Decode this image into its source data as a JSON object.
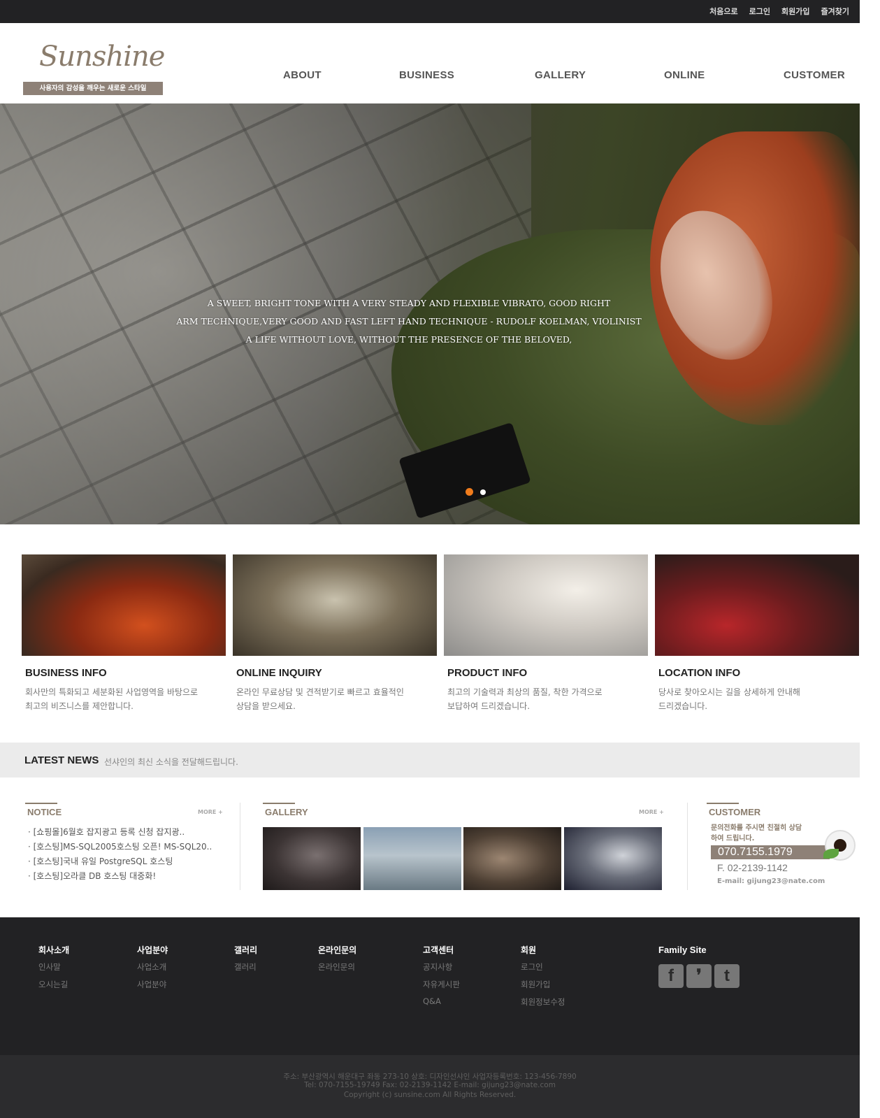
{
  "top_links": [
    "처음으로",
    "로그인",
    "회원가입",
    "즐겨찾기"
  ],
  "logo": {
    "script": "Sunshine",
    "tagline": "사용자의 감성을 깨우는 새로운 스타일"
  },
  "nav": [
    "ABOUT",
    "BUSINESS",
    "GALLERY",
    "ONLINE",
    "CUSTOMER"
  ],
  "hero": {
    "lines": [
      "A SWEET, BRIGHT TONE WITH A VERY STEADY AND FLEXIBLE VIBRATO, GOOD RIGHT",
      "ARM TECHNIQUE,VERY GOOD AND FAST LEFT HAND TECHNIQUE - RUDOLF KOELMAN, VIOLINIST",
      "A LIFE WITHOUT LOVE, WITHOUT THE PRESENCE OF THE BELOVED,"
    ],
    "slides": 2,
    "active_slide": 1,
    "active_color": "#f07c1c"
  },
  "features": [
    {
      "title": "BUSINESS INFO",
      "desc": [
        "회사만의 특화되고 세분화된 사업영역을 바탕으로",
        "최고의 비즈니스를 제안합니다."
      ]
    },
    {
      "title": "ONLINE INQUIRY",
      "desc": [
        "온라인 무료상담 및 견적받기로 빠르고 효율적인",
        "상담을 받으세요."
      ]
    },
    {
      "title": "PRODUCT INFO",
      "desc": [
        "최고의 기술력과 최상의 품질, 착한 가격으로",
        "보답하여 드리겠습니다."
      ]
    },
    {
      "title": "LOCATION INFO",
      "desc": [
        "당사로 찾아오시는 길을 상세하게 안내해",
        "드리겠습니다."
      ]
    }
  ],
  "latest_news": {
    "title": "LATEST NEWS",
    "subtitle": "선샤인의 최신 소식을 전달해드립니다."
  },
  "notice": {
    "title": "NOTICE",
    "more": "MORE +",
    "items": [
      "· [쇼핑몰]6월호 잡지광고 등록 신청 잡지광..",
      "· [호스팅]MS-SQL2005호스팅 오픈! MS-SQL20..",
      "· [호스팅]국내 유일 PostgreSQL 호스팅",
      "· [호스팅]오라클 DB 호스팅 대중화!"
    ]
  },
  "gallery": {
    "title": "GALLERY",
    "more": "MORE +"
  },
  "customer": {
    "title": "CUSTOMER",
    "text": [
      "문의전화를 주시면 친절히 상담",
      "하여 드립니다."
    ],
    "phone": "070.7155.1979",
    "fax": "F. 02-2139-1142",
    "email": "E-mail: gijung23@nate.com"
  },
  "footer": {
    "columns": [
      {
        "head": "회사소개",
        "links": [
          "인사말",
          "오시는길"
        ]
      },
      {
        "head": "사업분야",
        "links": [
          "사업소개",
          "사업분야"
        ]
      },
      {
        "head": "갤러리",
        "links": [
          "갤러리"
        ]
      },
      {
        "head": "온라인문의",
        "links": [
          "온라인문의"
        ]
      },
      {
        "head": "고객센터",
        "links": [
          "공지사항",
          "자유게시판",
          "Q&A"
        ]
      },
      {
        "head": "회원",
        "links": [
          "로그인",
          "회원가입",
          "회원정보수정"
        ]
      }
    ],
    "family_site": "Family Site",
    "sns": [
      {
        "icon": "facebook-icon",
        "glyph": "f"
      },
      {
        "icon": "me2day-icon",
        "glyph": "❜"
      },
      {
        "icon": "twitter-icon",
        "glyph": "t"
      }
    ],
    "copyright": [
      "주소: 부산광역시 해운대구 좌동 273-10  상호: 디자인선샤인  사업자등록번호: 123-456-7890",
      "Tel: 070-7155-19749  Fax: 02-2139-1142  E-mail: gijung23@nate.com",
      "Copyright (c) sunsine.com All Rights Reserved."
    ]
  },
  "colors": {
    "accent": "#8a7c6c",
    "dark": "#222224",
    "orange": "#f07c1c"
  }
}
